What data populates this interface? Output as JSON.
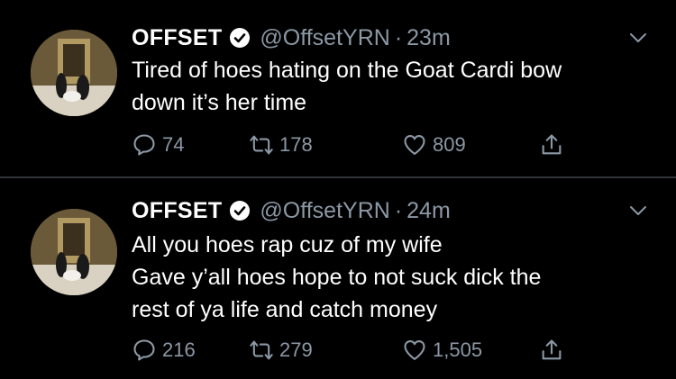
{
  "tweets": [
    {
      "name": "OFFSET",
      "handle": "@OffsetYRN",
      "dot": "·",
      "time": "23m",
      "lines": [
        "Tired of hoes hating on the Goat  Cardi bow",
        "down it’s her time"
      ],
      "replies": "74",
      "retweets": "178",
      "likes": "809"
    },
    {
      "name": "OFFSET",
      "handle": "@OffsetYRN",
      "dot": "·",
      "time": "24m",
      "lines": [
        "All you hoes rap cuz of my wife",
        "Gave y’all hoes hope to not suck dick the",
        "rest of ya life and catch money"
      ],
      "replies": "216",
      "retweets": "279",
      "likes": "1,505"
    }
  ],
  "icons": {
    "verified": "verified-badge-icon",
    "reply": "reply-icon",
    "retweet": "retweet-icon",
    "like": "heart-icon",
    "share": "share-icon",
    "more": "chevron-down-icon"
  },
  "colors": {
    "background": "#000000",
    "text": "#ffffff",
    "secondary": "#8b98a5",
    "divider": "#2f3336"
  }
}
